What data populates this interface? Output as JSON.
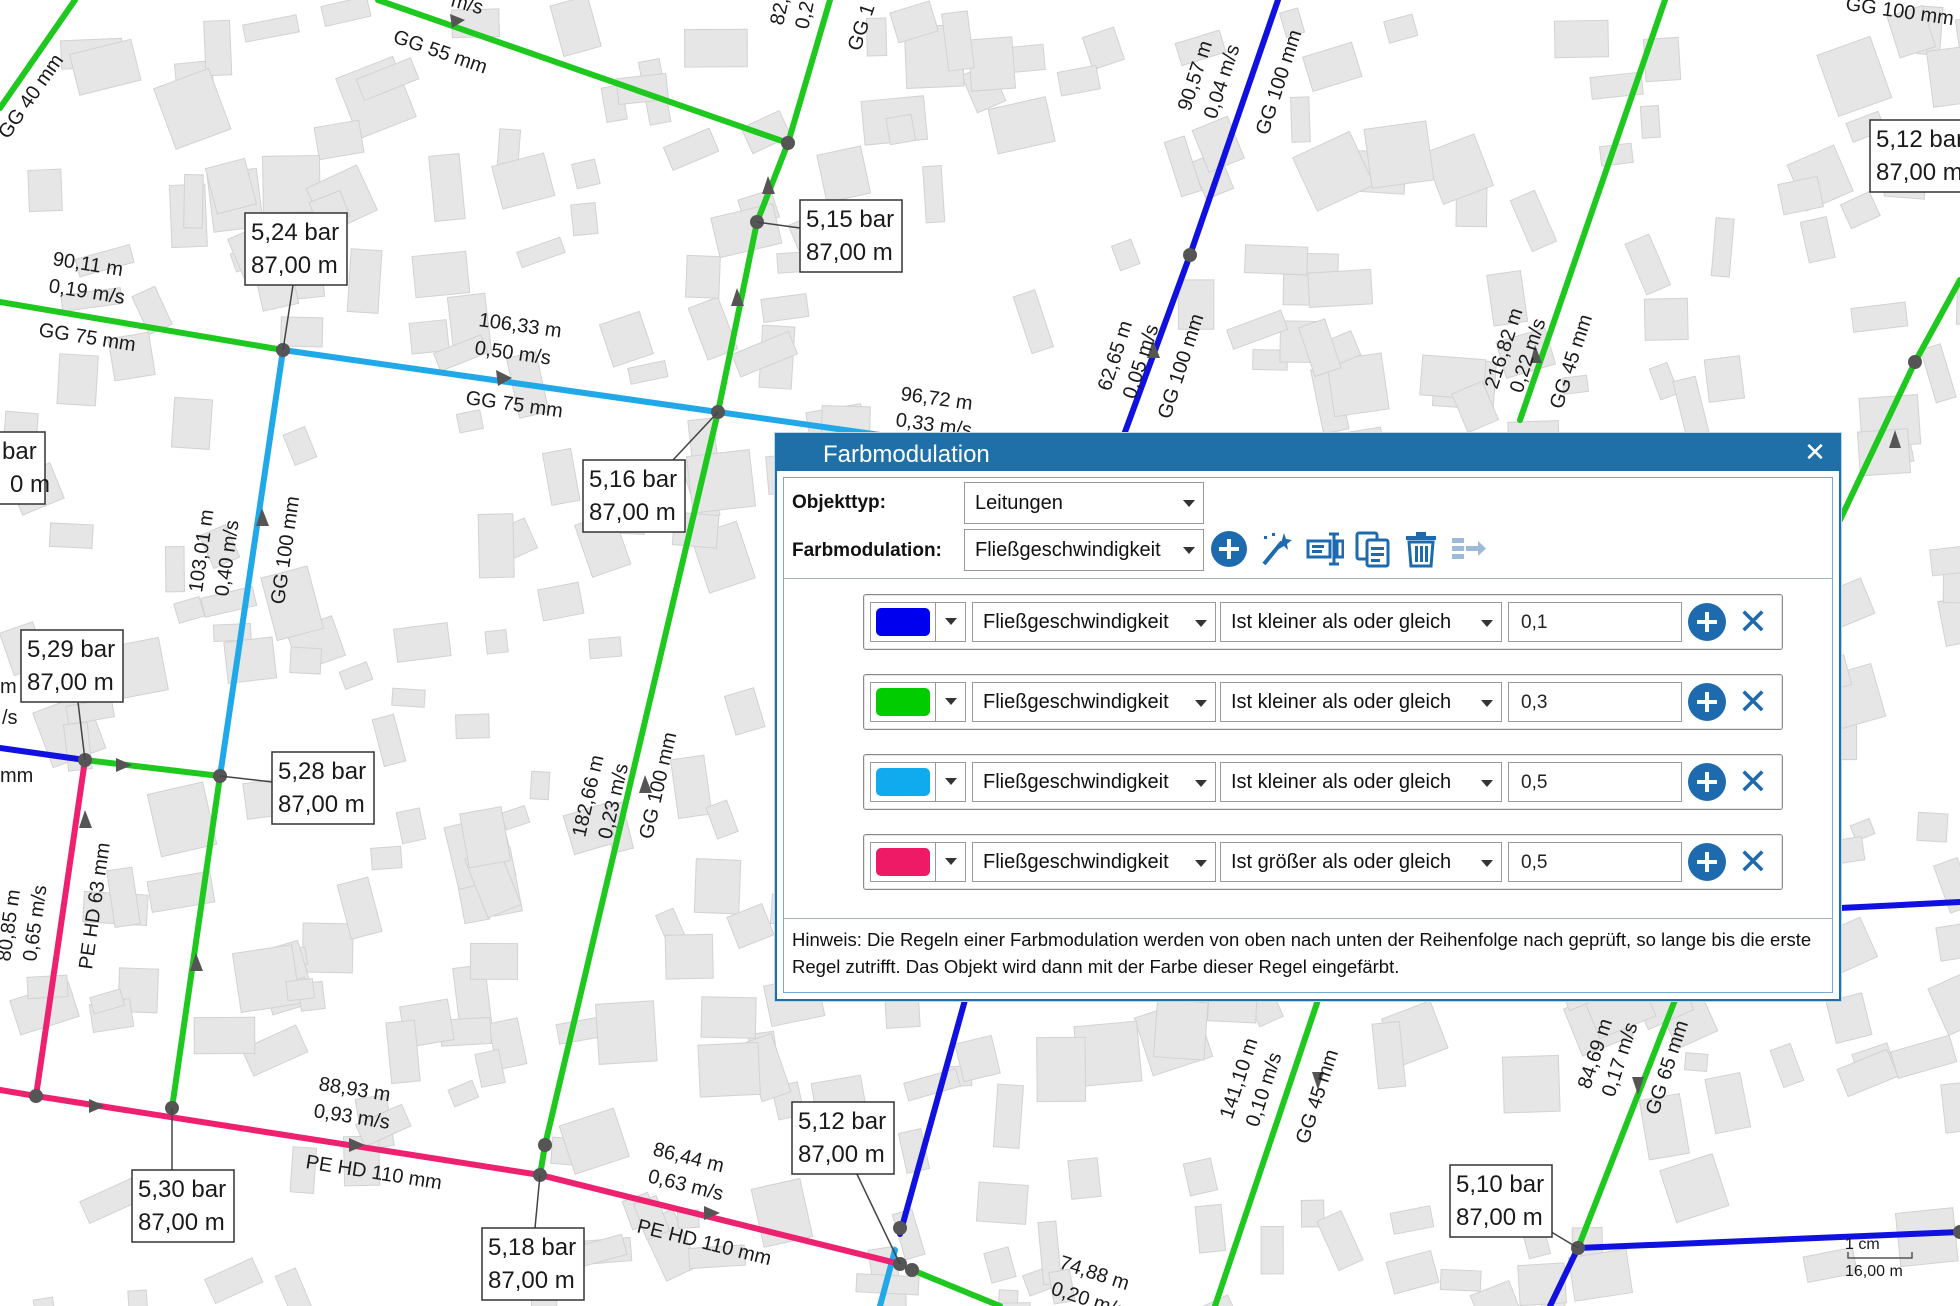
{
  "map": {
    "node_labels": [
      {
        "pressure": "5,24 bar",
        "height": "87,00 m"
      },
      {
        "pressure": "5,15 bar",
        "height": "87,00 m"
      },
      {
        "pressure": "5,16 bar",
        "height": "87,00 m"
      },
      {
        "pressure": "5,29 bar",
        "height": "87,00 m"
      },
      {
        "pressure": "5,28 bar",
        "height": "87,00 m"
      },
      {
        "pressure": "5,30 bar",
        "height": "87,00 m"
      },
      {
        "pressure": "5,18 bar",
        "height": "87,00 m"
      },
      {
        "pressure": "5,12 bar",
        "height": "87,00 m"
      },
      {
        "pressure": "5,10 bar",
        "height": "87,00 m"
      },
      {
        "pressure": "5,12 bar",
        "height": "87,00 m"
      },
      {
        "pressure": "bar",
        "height": "0 m"
      }
    ],
    "pipe_labels": [
      "90,11 m",
      "0,19 m/s",
      "GG 75 mm",
      "106,33 m",
      "0,50 m/s",
      "GG 75 mm",
      "96,72 m",
      "0,33 m/s",
      "GG 55 mm",
      "GG 40 mm",
      "82,",
      "0,2",
      "GG 1",
      "m/s",
      "90,57 m",
      "0,04 m/s",
      "GG 100 mm",
      "62,65 m",
      "0,05 m/s",
      "GG 100 mm",
      "216,82 m",
      "0,22 m/s",
      "GG 45 mm",
      "GG 100 mm",
      "103,01 m",
      "0,40 m/s",
      "GG 100 mm",
      "182,66 m",
      "0,23 m/s",
      "GG 100 mm",
      "80,85 m",
      "0,65 m/s",
      "PE HD 63 mm",
      "88,93 m",
      "0,93 m/s",
      "PE HD 110 mm",
      "86,44 m",
      "0,63 m/s",
      "PE HD 110 mm",
      "74,88 m",
      "0,20 m/s",
      "141,10 m",
      "0,10 m/s",
      "GG 45 mm",
      "84,69 m",
      "0,17 m/s",
      "GG 65 mm",
      "m",
      "/s",
      "mm"
    ],
    "scale": {
      "top": "1 cm",
      "bottom": "16,00 m"
    },
    "colors": {
      "green": "#1fc81f",
      "blue": "#1010e0",
      "cyan": "#20a8e8",
      "pink": "#ee2070",
      "building": "#e6e6e6"
    }
  },
  "dialog": {
    "title": "Farbmodulation",
    "close_icon": "close-icon",
    "objekttyp_label": "Objekttyp:",
    "objekttyp_value": "Leitungen",
    "farbmodulation_label": "Farbmodulation:",
    "farbmodulation_value": "Fließgeschwindigkeit",
    "toolbar_icons": [
      "add-icon",
      "magic-wand-icon",
      "edit-icon",
      "copy-icon",
      "delete-icon",
      "apply-icon"
    ],
    "rules": [
      {
        "color": "#0000ee",
        "attribute": "Fließgeschwindigkeit",
        "operator": "Ist kleiner als oder gleich",
        "value": "0,1"
      },
      {
        "color": "#00cc00",
        "attribute": "Fließgeschwindigkeit",
        "operator": "Ist kleiner als oder gleich",
        "value": "0,3"
      },
      {
        "color": "#10aaee",
        "attribute": "Fließgeschwindigkeit",
        "operator": "Ist kleiner als oder gleich",
        "value": "0,5"
      },
      {
        "color": "#ee1a66",
        "attribute": "Fließgeschwindigkeit",
        "operator": "Ist größer als oder gleich",
        "value": "0,5"
      }
    ],
    "hint": "Hinweis: Die Regeln einer Farbmodulation werden von oben nach unten der Reihenfolge nach geprüft, so lange bis die erste Regel zutrifft. Das Objekt wird dann mit der Farbe dieser Regel eingefärbt."
  }
}
